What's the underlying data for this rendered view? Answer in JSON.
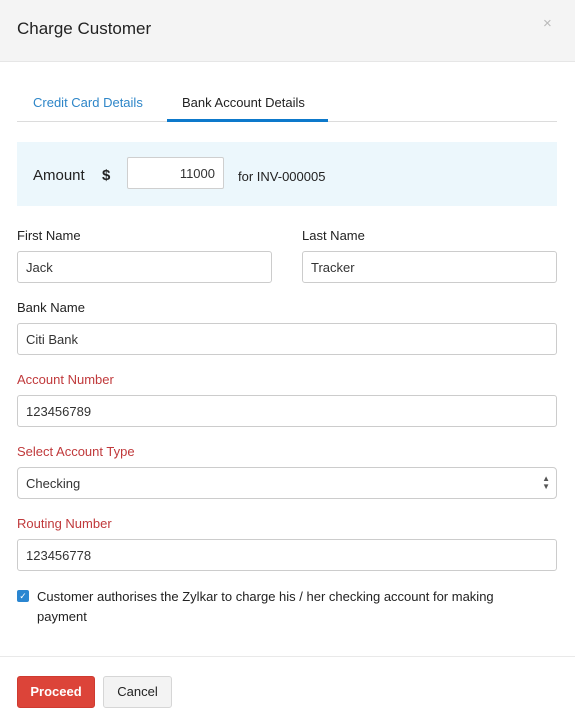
{
  "dialog": {
    "title": "Charge Customer",
    "close_icon": "×"
  },
  "tabs": [
    {
      "label": "Credit Card Details",
      "active": false
    },
    {
      "label": "Bank Account Details",
      "active": true
    }
  ],
  "amount": {
    "label": "Amount",
    "currency_symbol": "$",
    "value": "11000",
    "invoice_text": "for INV-000005"
  },
  "form": {
    "first_name": {
      "label": "First Name",
      "value": "Jack"
    },
    "last_name": {
      "label": "Last Name",
      "value": "Tracker"
    },
    "bank_name": {
      "label": "Bank Name",
      "value": "Citi Bank"
    },
    "account_number": {
      "label": "Account Number",
      "value": "123456789",
      "required": true
    },
    "account_type": {
      "label": "Select Account Type",
      "value": "Checking",
      "required": true
    },
    "routing_number": {
      "label": "Routing Number",
      "value": "123456778",
      "required": true
    }
  },
  "consent": {
    "checked": true,
    "check_glyph": "✓",
    "text": "Customer authorises the Zylkar to charge his / her checking account for making payment"
  },
  "footer": {
    "proceed_label": "Proceed",
    "cancel_label": "Cancel"
  },
  "colors": {
    "primary_button": "#dc4439",
    "active_tab": "#0d79cb",
    "link": "#2e86c8",
    "required_label": "#c0393b",
    "amount_panel_bg": "#ecf7fc"
  }
}
